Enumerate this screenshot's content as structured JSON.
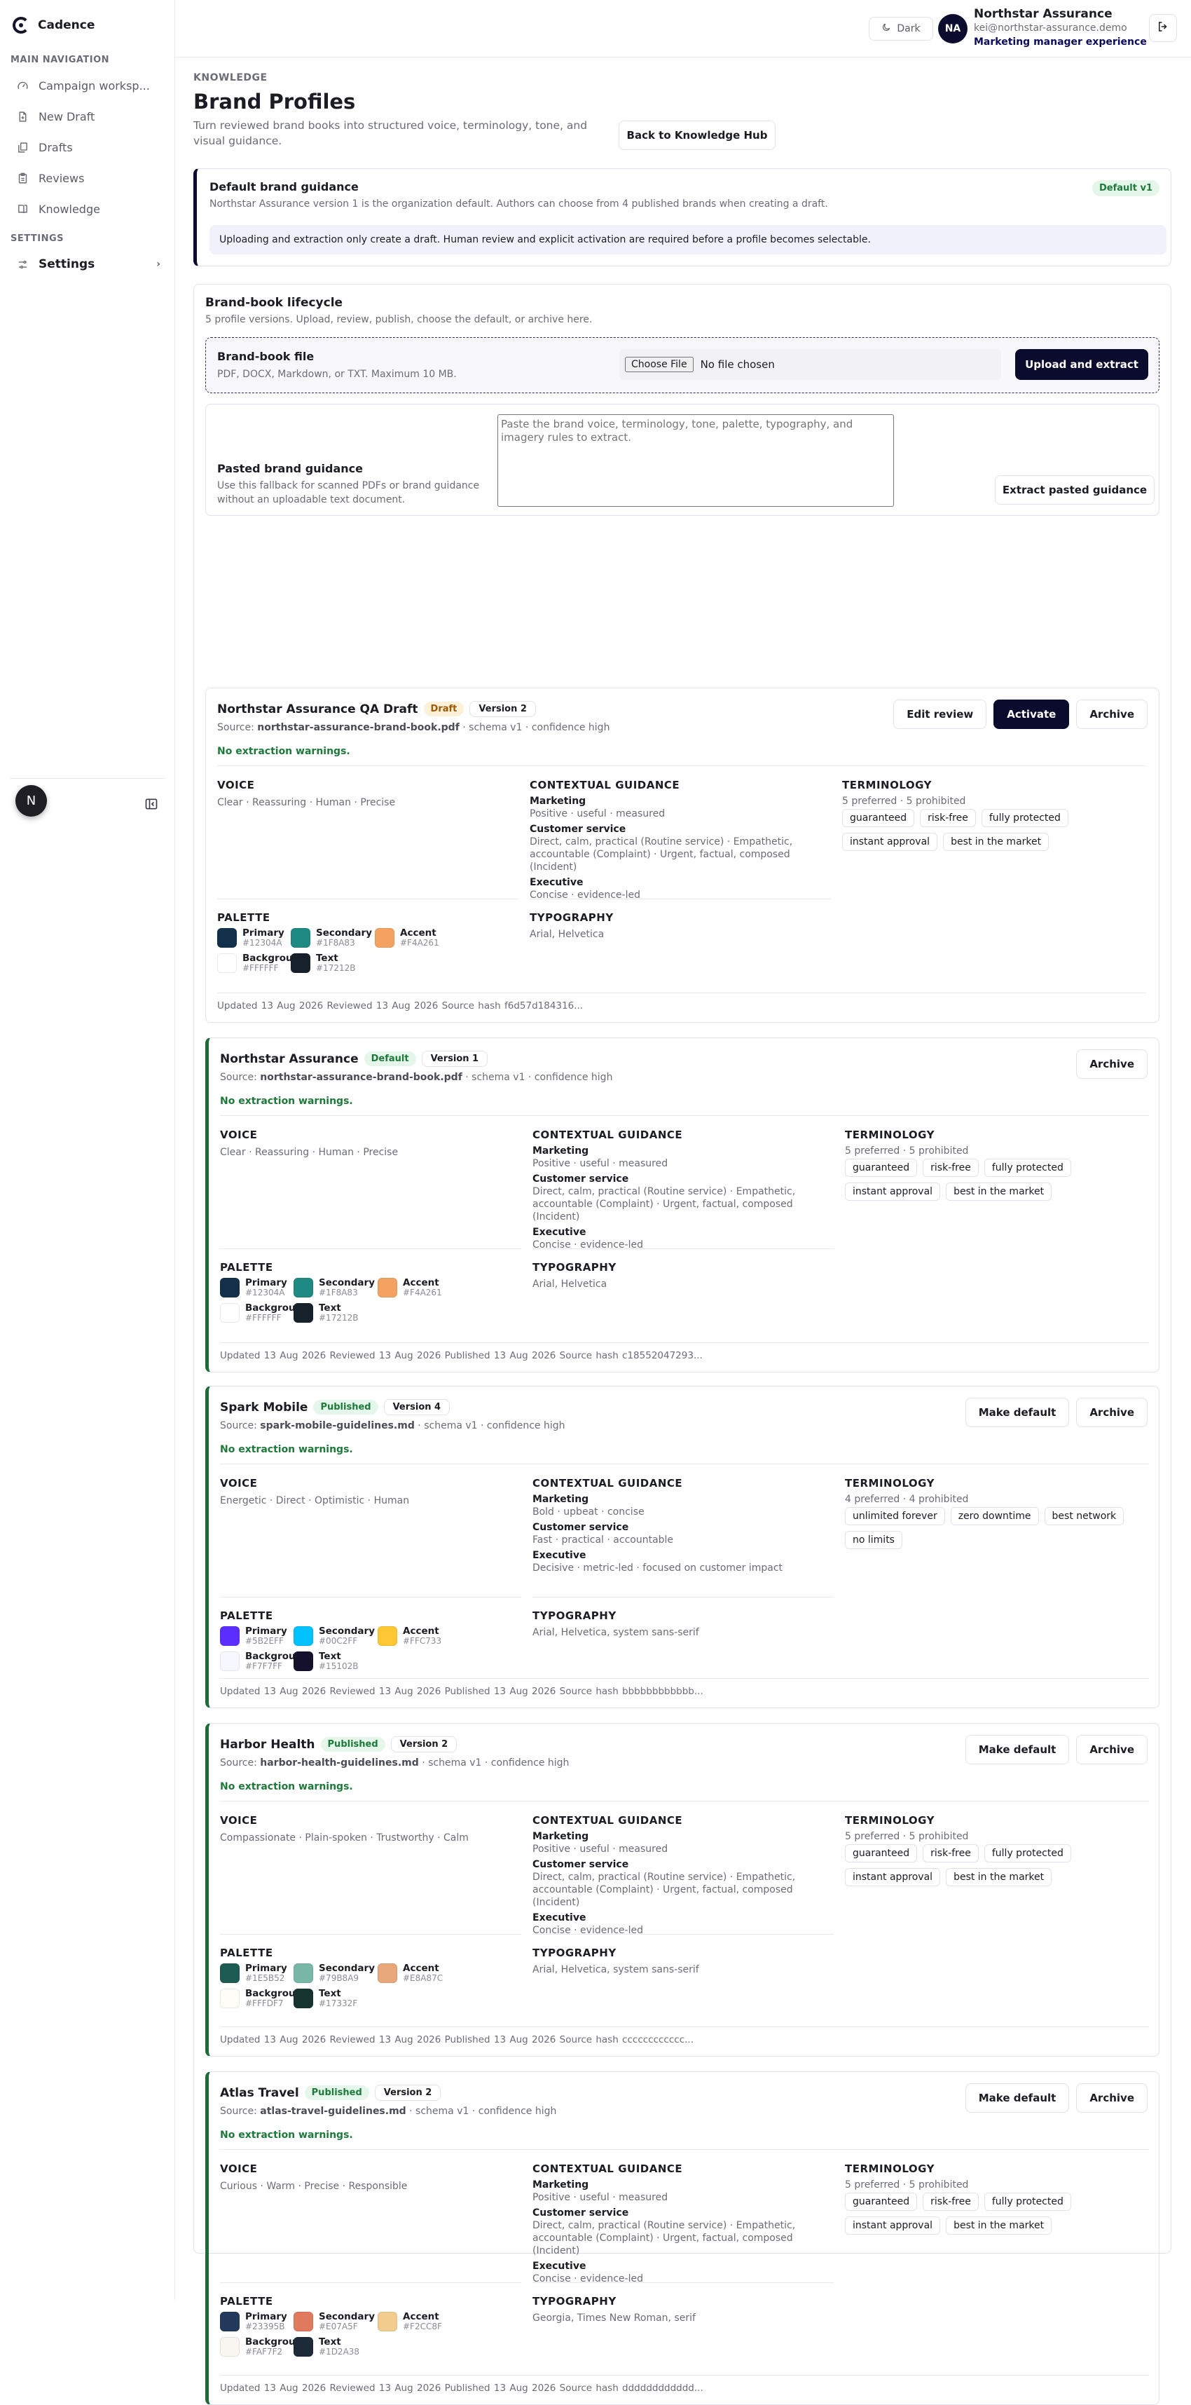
{
  "app": {
    "name": "Cadence"
  },
  "sidebar": {
    "main_heading": "MAIN NAVIGATION",
    "items": [
      {
        "label": "Campaign worksp...",
        "icon": "gauge-icon"
      },
      {
        "label": "New Draft",
        "icon": "new-file-icon"
      },
      {
        "label": "Drafts",
        "icon": "files-icon"
      },
      {
        "label": "Reviews",
        "icon": "clipboard-icon"
      },
      {
        "label": "Knowledge",
        "icon": "book-icon"
      }
    ],
    "settings_heading": "SETTINGS",
    "settings_label": "Settings",
    "footer_avatar": "N"
  },
  "topbar": {
    "theme_label": "Dark",
    "user_initials": "NA",
    "user_name": "Northstar Assurance",
    "user_email": "kei@northstar-assurance.demo",
    "user_role": "Marketing manager experience"
  },
  "page": {
    "eyebrow": "KNOWLEDGE",
    "title": "Brand Profiles",
    "subtitle": "Turn reviewed brand books into structured voice, terminology, tone, and visual guidance.",
    "back_label": "Back to Knowledge Hub"
  },
  "default_guidance": {
    "title": "Default brand guidance",
    "text": "Northstar Assurance version 1 is the organization default. Authors can choose from 4 published brands when creating a draft.",
    "badge": "Default v1",
    "note": "Uploading and extraction only create a draft. Human review and explicit activation are required before a profile becomes selectable."
  },
  "lifecycle": {
    "title": "Brand-book lifecycle",
    "subtitle": "5 profile versions. Upload, review, publish, choose the default, or archive here.",
    "upload": {
      "title": "Brand-book file",
      "help": "PDF, DOCX, Markdown, or TXT. Maximum 10 MB.",
      "file_button": "Choose File",
      "file_status": "No file chosen",
      "submit": "Upload and extract"
    },
    "paste": {
      "title": "Pasted brand guidance",
      "help": "Use this fallback for scanned PDFs or brand guidance without an uploadable text document.",
      "placeholder": "Paste the brand voice, terminology, tone, palette, typography, and imagery rules to extract.",
      "submit": "Extract pasted guidance"
    }
  },
  "labels": {
    "voice": "VOICE",
    "contextual": "CONTEXTUAL GUIDANCE",
    "terminology": "TERMINOLOGY",
    "palette": "PALETTE",
    "typography": "TYPOGRAPHY",
    "no_warnings": "No extraction warnings.",
    "source_prefix": "Source:",
    "schema": " · schema v1 · confidence high",
    "ctx_marketing": "Marketing",
    "ctx_service": "Customer service",
    "ctx_exec": "Executive"
  },
  "profiles": [
    {
      "name": "Northstar Assurance QA Draft",
      "status": "Draft",
      "version": "Version 2",
      "source": "northstar-assurance-brand-book.pdf",
      "actions": [
        "Edit review",
        "Activate",
        "Archive"
      ],
      "voice": "Clear · Reassuring · Human · Precise",
      "marketing": "Positive · useful · measured",
      "service": "Direct, calm, practical (Routine service) · Empathetic, accountable (Complaint) · Urgent, factual, composed (Incident)",
      "executive": "Concise · evidence-led",
      "term_counts": "5 preferred · 5 prohibited",
      "terms": [
        "guaranteed",
        "risk-free",
        "fully protected",
        "instant approval",
        "best in the market"
      ],
      "palette": [
        {
          "name": "Primary",
          "hex": "#12304A"
        },
        {
          "name": "Secondary",
          "hex": "#1F8A83"
        },
        {
          "name": "Accent",
          "hex": "#F4A261"
        },
        {
          "name": "Background",
          "hex": "#FFFFFF"
        },
        {
          "name": "Text",
          "hex": "#17212B"
        }
      ],
      "typography": "Arial, Helvetica",
      "meta": "Updated 13 Aug 2026   Reviewed 13 Aug 2026   Source hash f6d57d184316..."
    },
    {
      "name": "Northstar Assurance",
      "status": "Default",
      "version": "Version 1",
      "source": "northstar-assurance-brand-book.pdf",
      "actions": [
        "Archive"
      ],
      "voice": "Clear · Reassuring · Human · Precise",
      "marketing": "Positive · useful · measured",
      "service": "Direct, calm, practical (Routine service) · Empathetic, accountable (Complaint) · Urgent, factual, composed (Incident)",
      "executive": "Concise · evidence-led",
      "term_counts": "5 preferred · 5 prohibited",
      "terms": [
        "guaranteed",
        "risk-free",
        "fully protected",
        "instant approval",
        "best in the market"
      ],
      "palette": [
        {
          "name": "Primary",
          "hex": "#12304A"
        },
        {
          "name": "Secondary",
          "hex": "#1F8A83"
        },
        {
          "name": "Accent",
          "hex": "#F4A261"
        },
        {
          "name": "Background",
          "hex": "#FFFFFF"
        },
        {
          "name": "Text",
          "hex": "#17212B"
        }
      ],
      "typography": "Arial, Helvetica",
      "meta": "Updated 13 Aug 2026   Reviewed 13 Aug 2026   Published 13 Aug 2026   Source hash c18552047293..."
    },
    {
      "name": "Spark Mobile",
      "status": "Published",
      "version": "Version 4",
      "source": "spark-mobile-guidelines.md",
      "actions": [
        "Make default",
        "Archive"
      ],
      "voice": "Energetic · Direct · Optimistic · Human",
      "marketing": "Bold · upbeat · concise",
      "service": "Fast · practical · accountable",
      "executive": "Decisive · metric-led · focused on customer impact",
      "term_counts": "4 preferred · 4 prohibited",
      "terms": [
        "unlimited forever",
        "zero downtime",
        "best network",
        "no limits"
      ],
      "palette": [
        {
          "name": "Primary",
          "hex": "#5B2EFF"
        },
        {
          "name": "Secondary",
          "hex": "#00C2FF"
        },
        {
          "name": "Accent",
          "hex": "#FFC733"
        },
        {
          "name": "Background",
          "hex": "#F7F7FF"
        },
        {
          "name": "Text",
          "hex": "#15102B"
        }
      ],
      "typography": "Arial, Helvetica, system sans-serif",
      "meta": "Updated 13 Aug 2026   Reviewed 13 Aug 2026   Published 13 Aug 2026   Source hash bbbbbbbbbbbb..."
    },
    {
      "name": "Harbor Health",
      "status": "Published",
      "version": "Version 2",
      "source": "harbor-health-guidelines.md",
      "actions": [
        "Make default",
        "Archive"
      ],
      "voice": "Compassionate · Plain-spoken · Trustworthy · Calm",
      "marketing": "Positive · useful · measured",
      "service": "Direct, calm, practical (Routine service) · Empathetic, accountable (Complaint) · Urgent, factual, composed (Incident)",
      "executive": "Concise · evidence-led",
      "term_counts": "5 preferred · 5 prohibited",
      "terms": [
        "guaranteed",
        "risk-free",
        "fully protected",
        "instant approval",
        "best in the market"
      ],
      "palette": [
        {
          "name": "Primary",
          "hex": "#1E5B52"
        },
        {
          "name": "Secondary",
          "hex": "#79B8A9"
        },
        {
          "name": "Accent",
          "hex": "#E8A87C"
        },
        {
          "name": "Background",
          "hex": "#FFFDF7"
        },
        {
          "name": "Text",
          "hex": "#17332F"
        }
      ],
      "typography": "Arial, Helvetica, system sans-serif",
      "meta": "Updated 13 Aug 2026   Reviewed 13 Aug 2026   Published 13 Aug 2026   Source hash cccccccccccc..."
    },
    {
      "name": "Atlas Travel",
      "status": "Published",
      "version": "Version 2",
      "source": "atlas-travel-guidelines.md",
      "actions": [
        "Make default",
        "Archive"
      ],
      "voice": "Curious · Warm · Precise · Responsible",
      "marketing": "Positive · useful · measured",
      "service": "Direct, calm, practical (Routine service) · Empathetic, accountable (Complaint) · Urgent, factual, composed (Incident)",
      "executive": "Concise · evidence-led",
      "term_counts": "5 preferred · 5 prohibited",
      "terms": [
        "guaranteed",
        "risk-free",
        "fully protected",
        "instant approval",
        "best in the market"
      ],
      "palette": [
        {
          "name": "Primary",
          "hex": "#23395B"
        },
        {
          "name": "Secondary",
          "hex": "#E07A5F"
        },
        {
          "name": "Accent",
          "hex": "#F2CC8F"
        },
        {
          "name": "Background",
          "hex": "#FAF7F2"
        },
        {
          "name": "Text",
          "hex": "#1D2A38"
        }
      ],
      "typography": "Georgia, Times New Roman, serif",
      "meta": "Updated 13 Aug 2026   Reviewed 13 Aug 2026   Published 13 Aug 2026   Source hash dddddddddddd..."
    }
  ]
}
